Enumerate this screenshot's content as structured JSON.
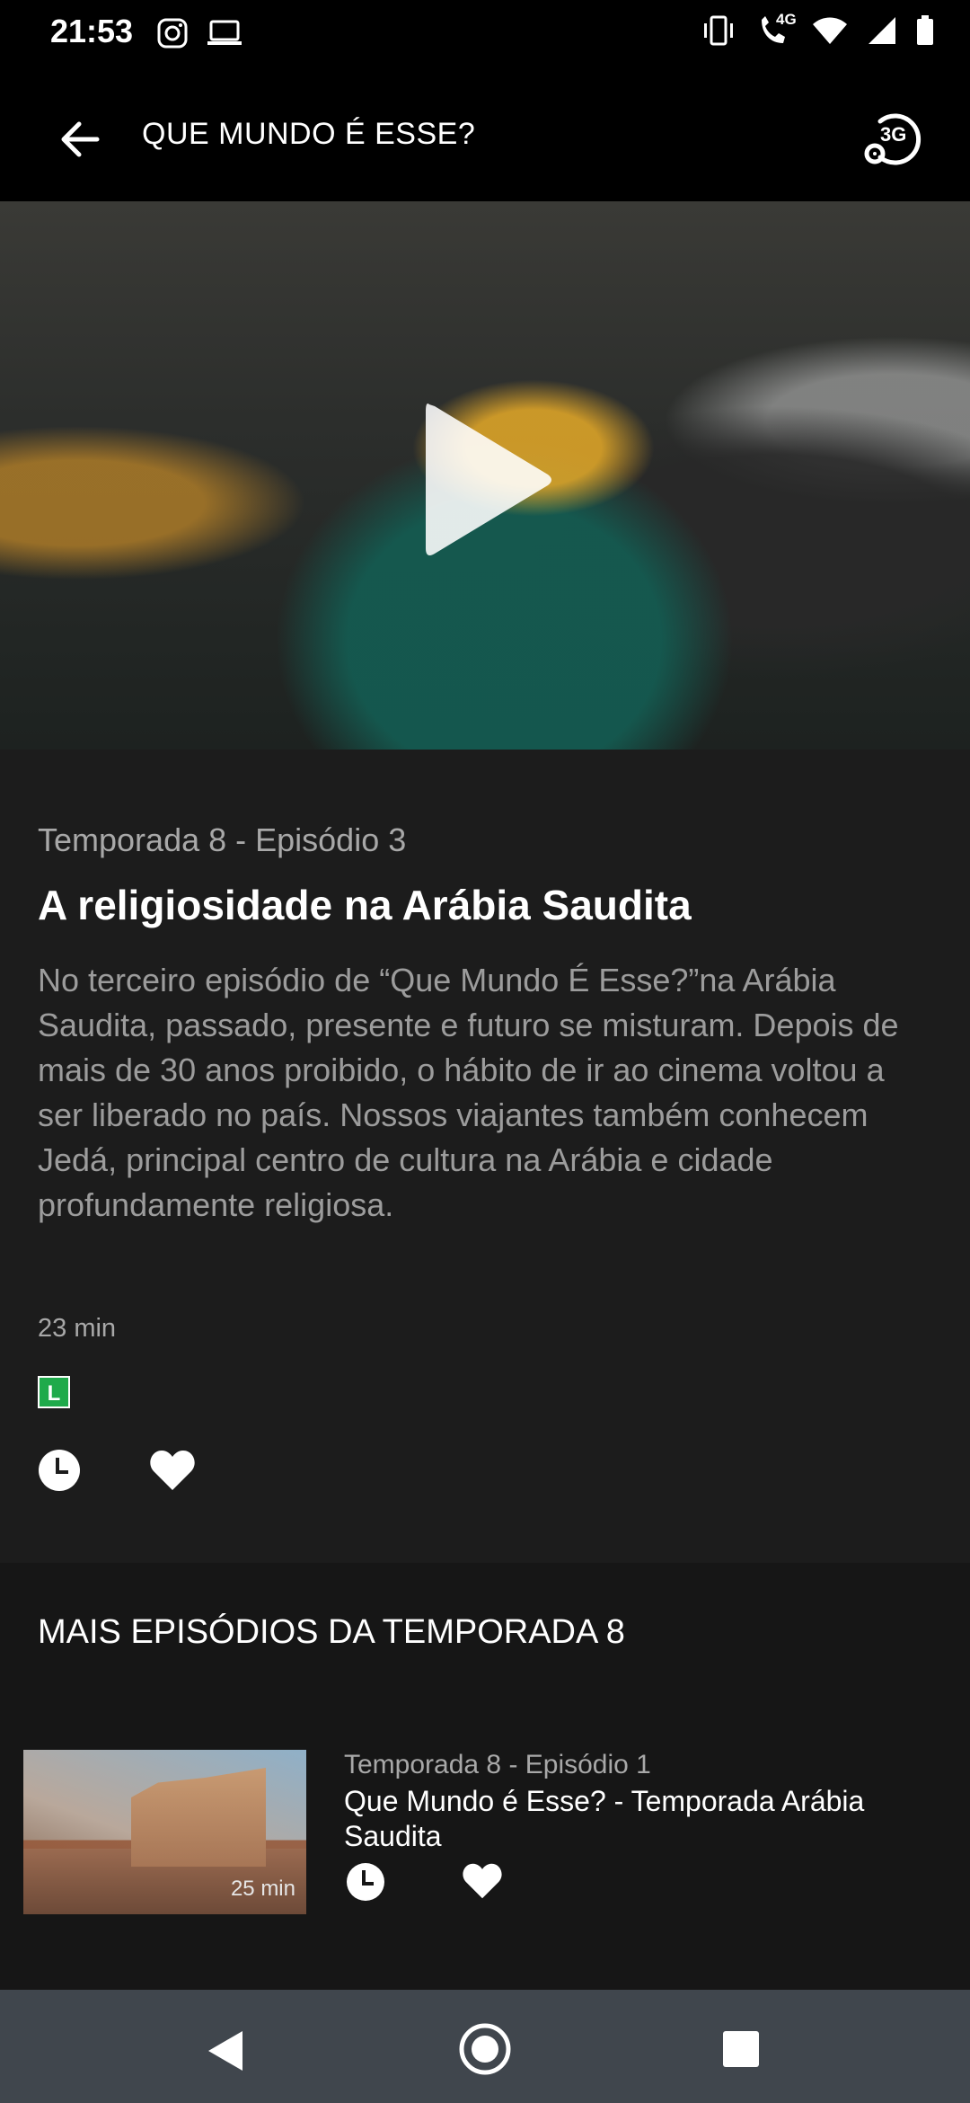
{
  "status_bar": {
    "time": "21:53",
    "network_label": "4G",
    "icons": [
      "instagram-icon",
      "laptop-icon",
      "vibrate-icon",
      "wifi-call-icon",
      "wifi-icon",
      "signal-icon",
      "battery-icon"
    ]
  },
  "header": {
    "title": "QUE MUNDO É ESSE?",
    "quality_label": "3G"
  },
  "episode": {
    "season_episode": "Temporada 8 - Episódio 3",
    "title": "A religiosidade na Arábia Saudita",
    "description": "No terceiro episódio de “Que Mundo É Esse?”na Arábia Saudita, passado, presente e futuro se misturam. Depois de mais de 30 anos proibido, o hábito de ir ao cinema voltou a ser liberado no país. Nossos viajantes também conhecem Jedá, principal centro de cultura na Arábia e cidade profundamente religiosa.",
    "duration": "23 min",
    "rating": "L",
    "rating_color": "#1faa4b"
  },
  "more_episodes": {
    "title": "MAIS EPISÓDIOS DA TEMPORADA 8",
    "items": [
      {
        "season_episode": "Temporada 8 - Episódio 1",
        "title": "Que Mundo é Esse? - Temporada Arábia Saudita",
        "duration": "25 min"
      }
    ]
  },
  "colors": {
    "background": "#1b1b1c",
    "nav_bar": "#40464d",
    "muted_text": "#9c9c9c"
  }
}
